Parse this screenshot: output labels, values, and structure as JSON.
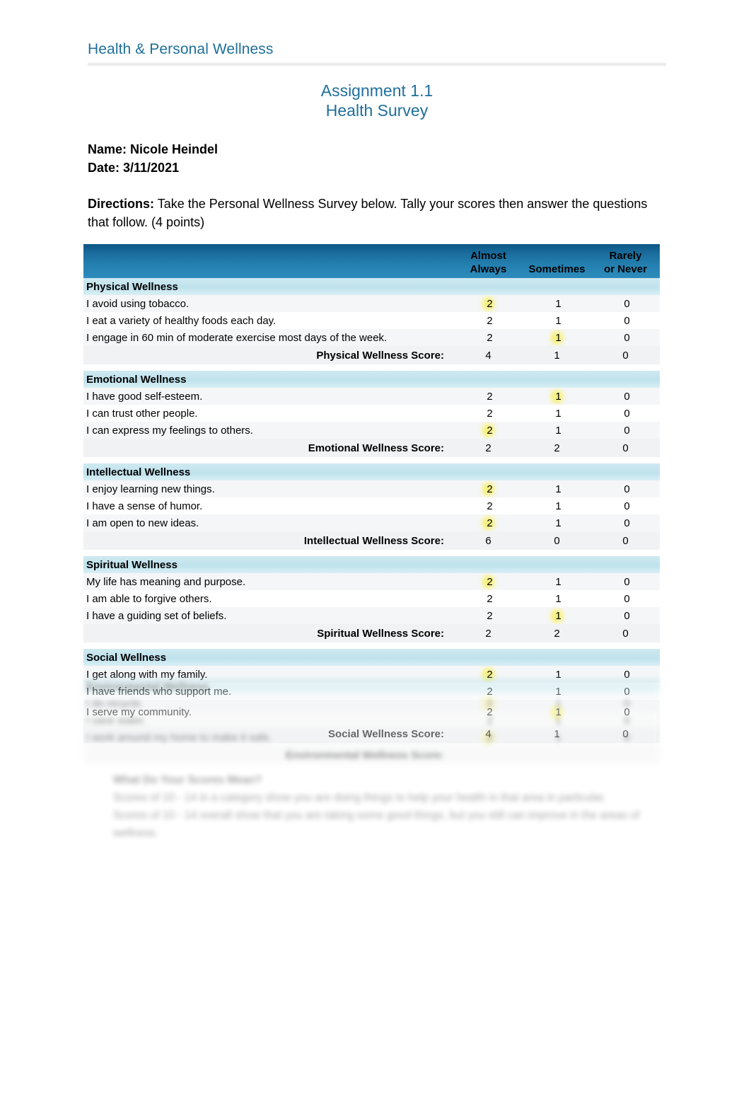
{
  "document": {
    "running_header": "Health & Personal Wellness",
    "assignment_title_line1": "Assignment 1.1",
    "assignment_title_line2": "Health Survey",
    "name_line": "Name: Nicole Heindel",
    "date_line": "Date: 3/11/2021",
    "directions_label": "Directions:",
    "directions_text": "  Take the Personal Wellness Survey below.  Tally your scores then answer the questions that follow. (4 points)"
  },
  "colors": {
    "header_blue": "#1f6f9a",
    "table_header_band": "#1a6e9e",
    "section_band": "#bfe2ec",
    "highlight_yellow": "#f4ee6e",
    "row_shade": "#f5f6f7"
  },
  "table": {
    "columns": {
      "item": "",
      "almost_always_l1": "Almost",
      "almost_always_l2": "Always",
      "sometimes": "Sometimes",
      "rarely_l1": "Rarely",
      "rarely_l2": "or Never"
    },
    "sections": [
      {
        "title": "Physical Wellness",
        "items": [
          {
            "text": "I avoid using tobacco.",
            "always": "2",
            "sometimes": "1",
            "rarely": "0",
            "selected": "always"
          },
          {
            "text": "I eat a variety of healthy foods each day.",
            "always": "2",
            "sometimes": "1",
            "rarely": "0",
            "selected": "always"
          },
          {
            "text": "I engage in 60 min of moderate exercise most days of the week.",
            "always": "2",
            "sometimes": "1",
            "rarely": "0",
            "selected": "sometimes"
          }
        ],
        "score_label": "Physical Wellness Score:",
        "score": {
          "always": "4",
          "sometimes": "1",
          "rarely": "0"
        }
      },
      {
        "title": "Emotional Wellness",
        "items": [
          {
            "text": "I have good self-esteem.",
            "always": "2",
            "sometimes": "1",
            "rarely": "0",
            "selected": "sometimes"
          },
          {
            "text": "I can trust other people.",
            "always": "2",
            "sometimes": "1",
            "rarely": "0",
            "selected": "sometimes"
          },
          {
            "text": "I can express my feelings to others.",
            "always": "2",
            "sometimes": "1",
            "rarely": "0",
            "selected": "always"
          }
        ],
        "score_label": "Emotional Wellness Score:",
        "score": {
          "always": "2",
          "sometimes": "2",
          "rarely": "0"
        }
      },
      {
        "title": "Intellectual Wellness",
        "items": [
          {
            "text": "I enjoy learning new things.",
            "always": "2",
            "sometimes": "1",
            "rarely": "0",
            "selected": "always"
          },
          {
            "text": "I have a sense of humor.",
            "always": "2",
            "sometimes": "1",
            "rarely": "0",
            "selected": "always"
          },
          {
            "text": "I am open to new ideas.",
            "always": "2",
            "sometimes": "1",
            "rarely": "0",
            "selected": "always"
          }
        ],
        "score_label": "Intellectual Wellness Score:",
        "score": {
          "always": "6",
          "sometimes": "0",
          "rarely": "0"
        }
      },
      {
        "title": "Spiritual Wellness",
        "items": [
          {
            "text": "My life has meaning and purpose.",
            "always": "2",
            "sometimes": "1",
            "rarely": "0",
            "selected": "always"
          },
          {
            "text": "I am able to forgive others.",
            "always": "2",
            "sometimes": "1",
            "rarely": "0",
            "selected": "sometimes"
          },
          {
            "text": "I have a guiding set of beliefs.",
            "always": "2",
            "sometimes": "1",
            "rarely": "0",
            "selected": "sometimes"
          }
        ],
        "score_label": "Spiritual Wellness Score:",
        "score": {
          "always": "2",
          "sometimes": "2",
          "rarely": "0"
        }
      },
      {
        "title": "Social Wellness",
        "items": [
          {
            "text": "I get along with my family.",
            "always": "2",
            "sometimes": "1",
            "rarely": "0",
            "selected": "always"
          },
          {
            "text": "I have friends who support me.",
            "always": "2",
            "sometimes": "1",
            "rarely": "0",
            "selected": "always"
          },
          {
            "text": "I serve my community.",
            "always": "2",
            "sometimes": "1",
            "rarely": "0",
            "selected": "sometimes",
            "tall": true
          }
        ],
        "score_label": "Social Wellness Score:",
        "score": {
          "always": "4",
          "sometimes": "1",
          "rarely": "0"
        }
      }
    ],
    "faded_section": {
      "title": "Environmental Wellness",
      "items": [
        {
          "text": "I do recycle.",
          "always": "2",
          "sometimes": "1",
          "rarely": "0",
          "selected": "always"
        },
        {
          "text": "I save water.",
          "always": "2",
          "sometimes": "1",
          "rarely": "0",
          "selected": "always"
        },
        {
          "text": "I work around my home to make it safe.",
          "always": "2",
          "sometimes": "1",
          "rarely": "0",
          "selected": "always"
        }
      ],
      "score_label": "Environmental Wellness Score:",
      "score": {
        "always": "",
        "sometimes": "",
        "rarely": ""
      }
    }
  },
  "bottom_note": {
    "heading": "What Do Your Scores Mean?",
    "paragraph1": "Scores of 10 - 14 in a category show you are doing things to help your health in that area in particular.",
    "paragraph2": "Scores of 10 - 14 overall show that you are taking some good things, but you still can improve in the areas of wellness."
  }
}
